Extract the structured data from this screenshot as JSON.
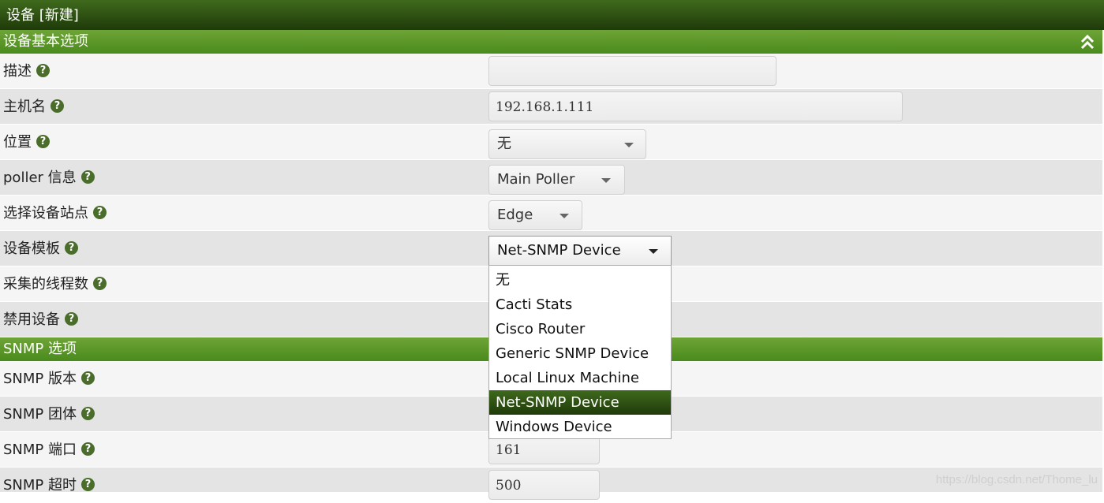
{
  "window": {
    "title": "设备 [新建]"
  },
  "sections": {
    "basic": {
      "title": "设备基本选项",
      "collapse_icon": "double-chevron-up-icon"
    },
    "snmp": {
      "title": "SNMP 选项"
    }
  },
  "help_icon_glyph": "?",
  "fields": {
    "description": {
      "label": "描述",
      "value": ""
    },
    "hostname": {
      "label": "主机名",
      "value": "192.168.1.111"
    },
    "location": {
      "label": "位置",
      "value": "无"
    },
    "poller": {
      "label": "poller 信息",
      "value": "Main Poller"
    },
    "site": {
      "label": "选择设备站点",
      "value": "Edge"
    },
    "template": {
      "label": "设备模板",
      "value": "Net-SNMP Device",
      "options": [
        "无",
        "Cacti Stats",
        "Cisco Router",
        "Generic SNMP Device",
        "Local Linux Machine",
        "Net-SNMP Device",
        "Windows Device"
      ],
      "selected_index": 5
    },
    "threads": {
      "label": "采集的线程数"
    },
    "disable": {
      "label": "禁用设备"
    },
    "snmp_version": {
      "label": "SNMP 版本"
    },
    "snmp_community": {
      "label": "SNMP 团体"
    },
    "snmp_port": {
      "label": "SNMP 端口",
      "value": "161"
    },
    "snmp_timeout": {
      "label": "SNMP 超时",
      "value": "500"
    }
  },
  "colors": {
    "title_bar": "#2e4f14",
    "section_bar": "#5c9a2a",
    "help_icon": "#4b6d2b",
    "selected_option": "#2e4f14"
  },
  "watermark": "https://blog.csdn.net/Thome_lu"
}
